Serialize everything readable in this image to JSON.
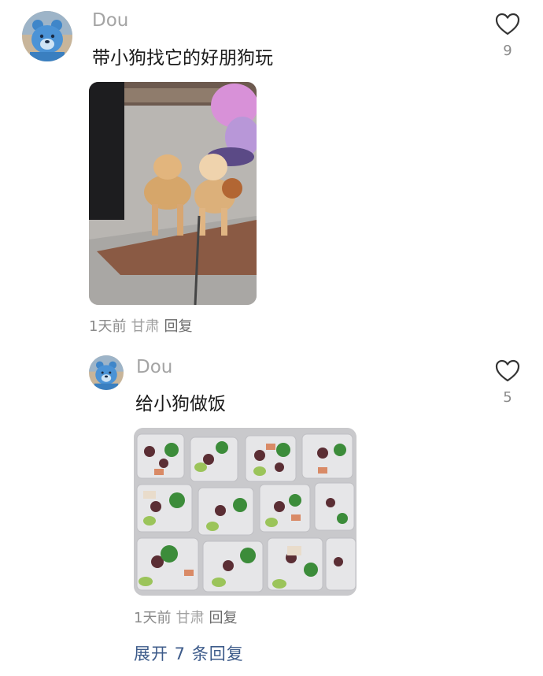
{
  "comment": {
    "username": "Dou",
    "text": "带小狗找它的好朋狗玩",
    "likes": "9",
    "time": "1天前",
    "location": "甘肃",
    "reply_label": "回复",
    "avatar_icon": "care-bear-avatar",
    "image_icon": "shiba-dogs-photo"
  },
  "reply": {
    "username": "Dou",
    "text": "给小狗做饭",
    "likes": "5",
    "time": "1天前",
    "location": "甘肃",
    "reply_label": "回复",
    "avatar_icon": "care-bear-avatar",
    "image_icon": "meal-prep-containers-photo"
  },
  "expand_replies_label": "展开 7 条回复",
  "colors": {
    "username": "#a4a4a4",
    "meta": "#8a8a8a",
    "expand_link": "#3d5b8a"
  }
}
